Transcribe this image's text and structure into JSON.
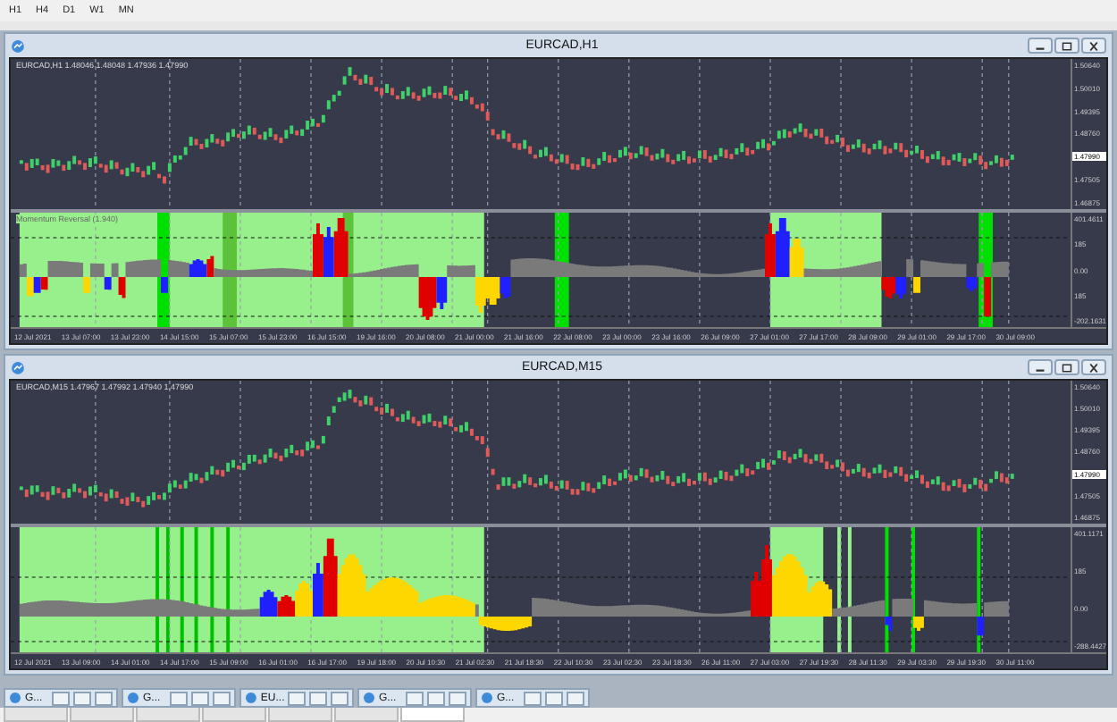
{
  "toolbar": {
    "timeframes": [
      "H1",
      "H4",
      "D1",
      "W1",
      "MN"
    ]
  },
  "windows": [
    {
      "title": "EURCAD,H1",
      "header": "EURCAD,H1  1.48046 1.48048 1.47936 1.47990",
      "indicator_label": "Momentum Reversal (1.940)",
      "price_axis": [
        {
          "label": "1.50640",
          "current": false
        },
        {
          "label": "1.50010",
          "current": false
        },
        {
          "label": "1.49395",
          "current": false
        },
        {
          "label": "1.48760",
          "current": false
        },
        {
          "label": "1.47990",
          "current": true
        },
        {
          "label": "1.47505",
          "current": false
        },
        {
          "label": "1.46875",
          "current": false
        }
      ],
      "indicator_axis": [
        "401.4611",
        "185",
        "0.00",
        "185",
        "-202.1631"
      ],
      "time_axis": [
        "12 Jul 2021",
        "13 Jul 07:00",
        "13 Jul 23:00",
        "14 Jul 15:00",
        "15 Jul 07:00",
        "15 Jul 23:00",
        "16 Jul 15:00",
        "19 Jul 16:00",
        "20 Jul 08:00",
        "21 Jul 00:00",
        "21 Jul 16:00",
        "22 Jul 08:00",
        "23 Jul 00:00",
        "23 Jul 16:00",
        "26 Jul 09:00",
        "27 Jul 01:00",
        "27 Jul 17:00",
        "28 Jul 09:00",
        "29 Jul 01:00",
        "29 Jul 17:00",
        "30 Jul 09:00"
      ]
    },
    {
      "title": "EURCAD,M15",
      "header": "EURCAD,M15  1.47967 1.47992 1.47940 1.47990",
      "price_axis": [
        {
          "label": "1.50640",
          "current": false
        },
        {
          "label": "1.50010",
          "current": false
        },
        {
          "label": "1.49395",
          "current": false
        },
        {
          "label": "1.48760",
          "current": false
        },
        {
          "label": "1.47990",
          "current": true
        },
        {
          "label": "1.47505",
          "current": false
        },
        {
          "label": "1.46875",
          "current": false
        }
      ],
      "indicator_axis": [
        "401.1171",
        "185",
        "0.00",
        "-288.4427"
      ],
      "time_axis": [
        "12 Jul 2021",
        "13 Jul 09:00",
        "14 Jul 01:00",
        "14 Jul 17:00",
        "15 Jul 09:00",
        "16 Jul 01:00",
        "16 Jul 17:00",
        "19 Jul 18:00",
        "20 Jul 10:30",
        "21 Jul 02:30",
        "21 Jul 18:30",
        "22 Jul 10:30",
        "23 Jul 02:30",
        "23 Jul 18:30",
        "26 Jul 11:00",
        "27 Jul 03:00",
        "27 Jul 19:30",
        "28 Jul 11:30",
        "29 Jul 03:30",
        "29 Jul 19:30",
        "30 Jul 11:00"
      ]
    }
  ],
  "minimized_windows": [
    "G...",
    "G...",
    "EU...",
    "G...",
    "G..."
  ],
  "chart_tabs": [
    {
      "selected": false
    },
    {
      "selected": false
    },
    {
      "selected": false
    },
    {
      "selected": false
    },
    {
      "selected": false
    },
    {
      "selected": false
    },
    {
      "selected": true
    }
  ]
}
